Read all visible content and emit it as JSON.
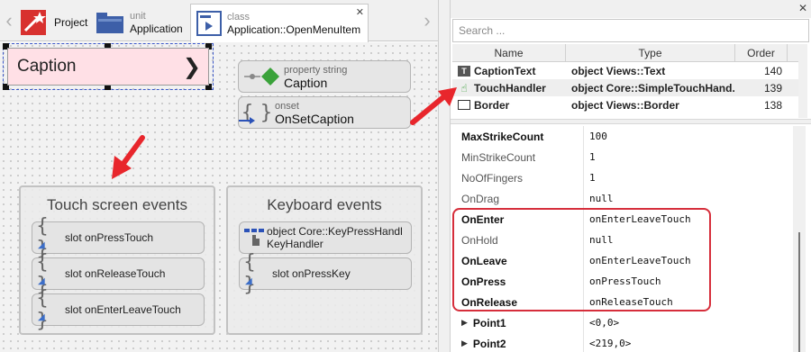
{
  "tabs": [
    {
      "kind": "",
      "name": "Project"
    },
    {
      "kind": "unit",
      "name": "Application"
    },
    {
      "kind": "class",
      "name": "Application::OpenMenuItem"
    }
  ],
  "canvas": {
    "caption_widget": {
      "text": "Caption",
      "chevron": "❯",
      "color": "#ffe0e6"
    },
    "property_brick": {
      "kind": "property string",
      "name": "Caption"
    },
    "onset_brick": {
      "kind": "onset",
      "name": "OnSetCaption"
    },
    "touch_group": {
      "title": "Touch screen events",
      "slots": [
        {
          "kind": "slot",
          "name": "onPressTouch"
        },
        {
          "kind": "slot",
          "name": "onReleaseTouch"
        },
        {
          "kind": "slot",
          "name": "onEnterLeaveTouch"
        }
      ]
    },
    "keyboard_group": {
      "title": "Keyboard events",
      "handler": {
        "kind": "object Core::KeyPressHandl",
        "name": "KeyHandler"
      },
      "slot": {
        "kind": "slot",
        "name": "onPressKey"
      }
    }
  },
  "inspector": {
    "search_placeholder": "Search ...",
    "members_header": {
      "name": "Name",
      "type": "Type",
      "order": "Order"
    },
    "members": [
      {
        "icon": "text-icon",
        "name": "CaptionText",
        "type": "object Views::Text",
        "order": "140"
      },
      {
        "icon": "touch-icon",
        "name": "TouchHandler",
        "type": "object Core::SimpleTouchHand...",
        "order": "139"
      },
      {
        "icon": "border-icon",
        "name": "Border",
        "type": "object Views::Border",
        "order": "138"
      }
    ],
    "properties": [
      {
        "name": "MaxStrikeCount",
        "value": "100",
        "bold": true
      },
      {
        "name": "MinStrikeCount",
        "value": "1",
        "bold": false
      },
      {
        "name": "NoOfFingers",
        "value": "1",
        "bold": false
      },
      {
        "name": "OnDrag",
        "value": "null",
        "bold": false
      },
      {
        "name": "OnEnter",
        "value": "onEnterLeaveTouch",
        "bold": true
      },
      {
        "name": "OnHold",
        "value": "null",
        "bold": false
      },
      {
        "name": "OnLeave",
        "value": "onEnterLeaveTouch",
        "bold": true
      },
      {
        "name": "OnPress",
        "value": "onPressTouch",
        "bold": true
      },
      {
        "name": "OnRelease",
        "value": "onReleaseTouch",
        "bold": true
      },
      {
        "name": "Point1",
        "value": "<0,0>",
        "bold": true,
        "expandable": true
      },
      {
        "name": "Point2",
        "value": "<219,0>",
        "bold": true,
        "expandable": true
      }
    ]
  },
  "colors": {
    "annotation": "#d62e3b",
    "selection": "#3a56c9",
    "caption_bg": "#ffe0e6"
  }
}
